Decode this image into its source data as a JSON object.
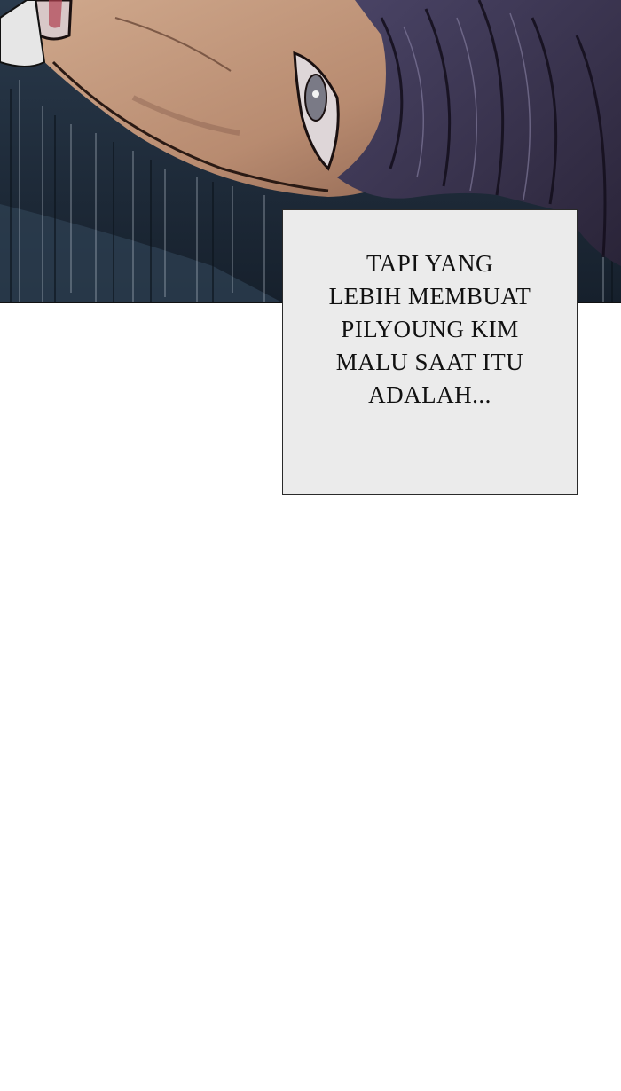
{
  "narration": {
    "lines": [
      "TAPI YANG",
      "LEBIH MEMBUAT",
      "PILYOUNG KIM",
      "MALU SAAT ITU",
      "ADALAH..."
    ]
  },
  "colors": {
    "background": "#ffffff",
    "caption_fill": "#ebebeb",
    "caption_border": "#2a2a2a",
    "caption_text": "#111111",
    "panel_shadow": "#1e2c3c",
    "skin": "#c59b80",
    "hair": "#3b3552"
  }
}
